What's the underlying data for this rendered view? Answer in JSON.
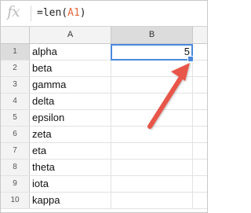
{
  "formula_bar": {
    "fx_label": "fx",
    "formula_prefix": "=len(",
    "formula_ref": "A1",
    "formula_suffix": ")"
  },
  "columns": [
    "A",
    "B"
  ],
  "rows": [
    {
      "num": "1",
      "a": "alpha",
      "b": "5"
    },
    {
      "num": "2",
      "a": "beta",
      "b": ""
    },
    {
      "num": "3",
      "a": "gamma",
      "b": ""
    },
    {
      "num": "4",
      "a": "delta",
      "b": ""
    },
    {
      "num": "5",
      "a": "epsilon",
      "b": ""
    },
    {
      "num": "6",
      "a": "zeta",
      "b": ""
    },
    {
      "num": "7",
      "a": "eta",
      "b": ""
    },
    {
      "num": "8",
      "a": "theta",
      "b": ""
    },
    {
      "num": "9",
      "a": "iota",
      "b": ""
    },
    {
      "num": "10",
      "a": "kappa",
      "b": ""
    }
  ],
  "colors": {
    "selection": "#4a89dc",
    "annotation_arrow": "#e8544a",
    "formula_reference": "#e8693e"
  }
}
